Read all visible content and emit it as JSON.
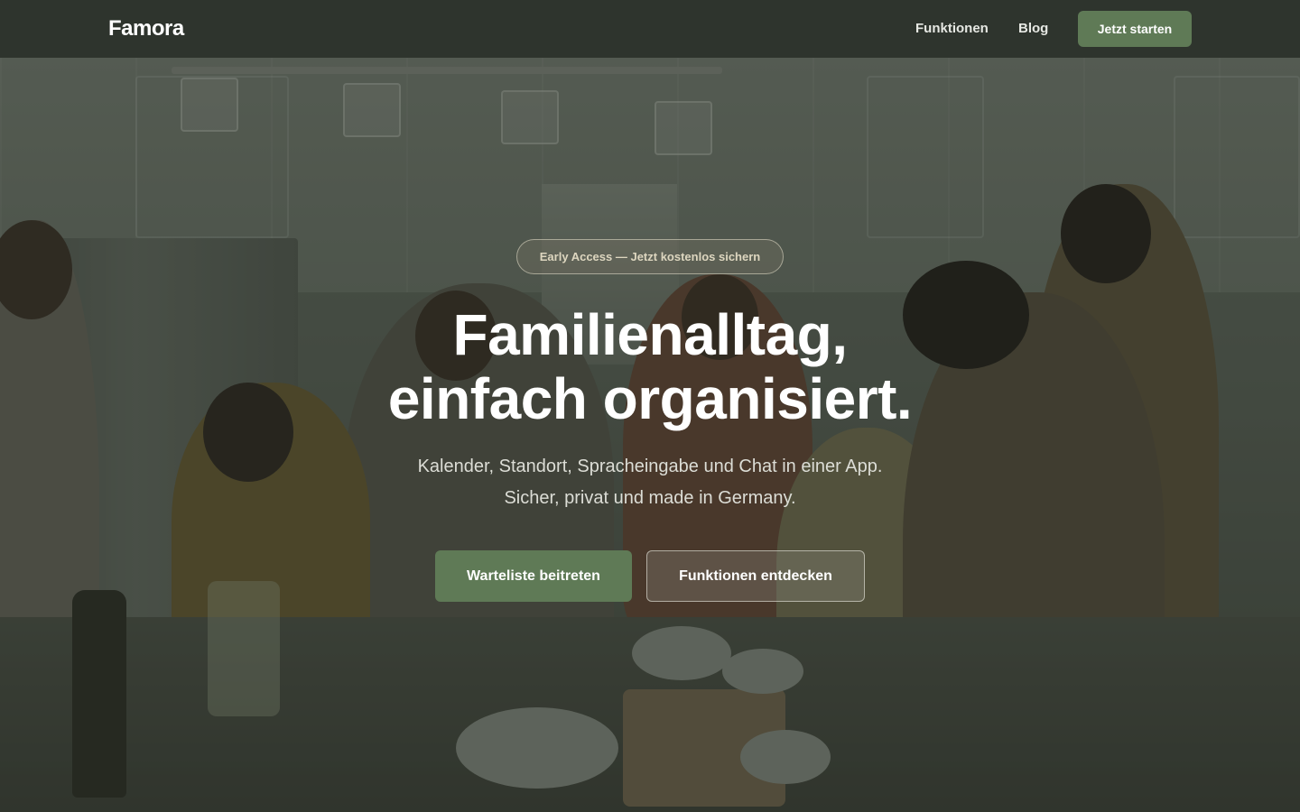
{
  "header": {
    "logo": "Famora",
    "nav": [
      {
        "label": "Funktionen"
      },
      {
        "label": "Blog"
      }
    ],
    "cta_label": "Jetzt starten"
  },
  "hero": {
    "badge": "Early Access — Jetzt kostenlos sichern",
    "headline_line1": "Familienalltag,",
    "headline_line2": "einfach organisiert.",
    "subline_line1": "Kalender, Standort, Spracheingabe und Chat in einer App.",
    "subline_line2": "Sicher, privat und made in Germany.",
    "primary_button": "Warteliste beitreten",
    "secondary_button": "Funktionen entdecken"
  },
  "colors": {
    "brand_green": "#5f7a56",
    "header_bg": "#2e342d",
    "badge_text": "#ddd6bf"
  }
}
